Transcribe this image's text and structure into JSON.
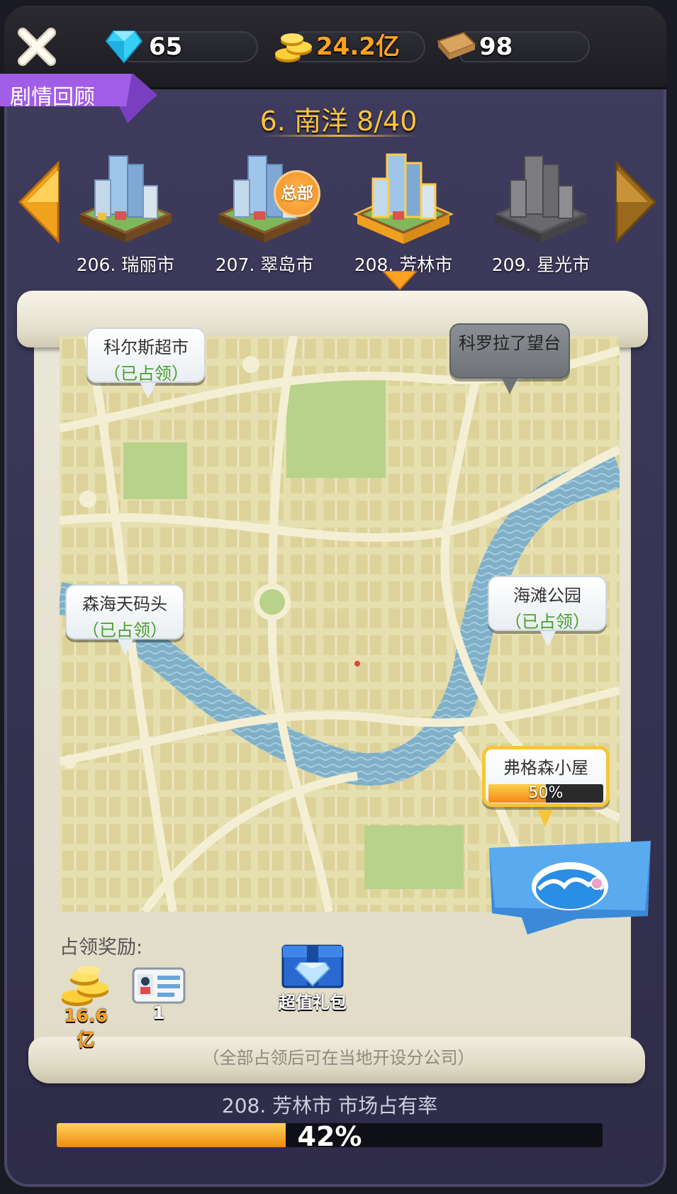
{
  "resources": {
    "diamonds": "65",
    "gold": "24.2亿",
    "tickets": "98"
  },
  "colors": {
    "gold_text": "#ffa21f",
    "accent": "#ffc43a",
    "occupied": "#47a02a",
    "story_tab": "#8a4fd0"
  },
  "story_tab": "剧情回顾",
  "region_title": "6. 南洋 8/40",
  "cities": [
    {
      "label": "206. 瑞丽市",
      "state": "unlocked"
    },
    {
      "label": "207. 翠岛市",
      "state": "unlocked",
      "badge": "总部"
    },
    {
      "label": "208. 芳林市",
      "state": "selected"
    },
    {
      "label": "209. 星光市",
      "state": "locked"
    }
  ],
  "locations": [
    {
      "name": "科尔斯超市",
      "status": "（已占领）"
    },
    {
      "name": "科罗拉了望台"
    },
    {
      "name": "森海天码头",
      "status": "（已占领）"
    },
    {
      "name": "海滩公园",
      "status": "（已占领）"
    },
    {
      "name": "弗格森小屋",
      "progress_text": "50%",
      "progress": 0.5
    }
  ],
  "rewards": {
    "label": "占领奖励:",
    "gold": "16.6亿",
    "card": "1",
    "gift": "超值礼包"
  },
  "hint": "（全部占领后可在当地开设分公司）",
  "market_share": {
    "label": "208. 芳林市 市场占有率",
    "text": "42%",
    "value": 0.42
  }
}
